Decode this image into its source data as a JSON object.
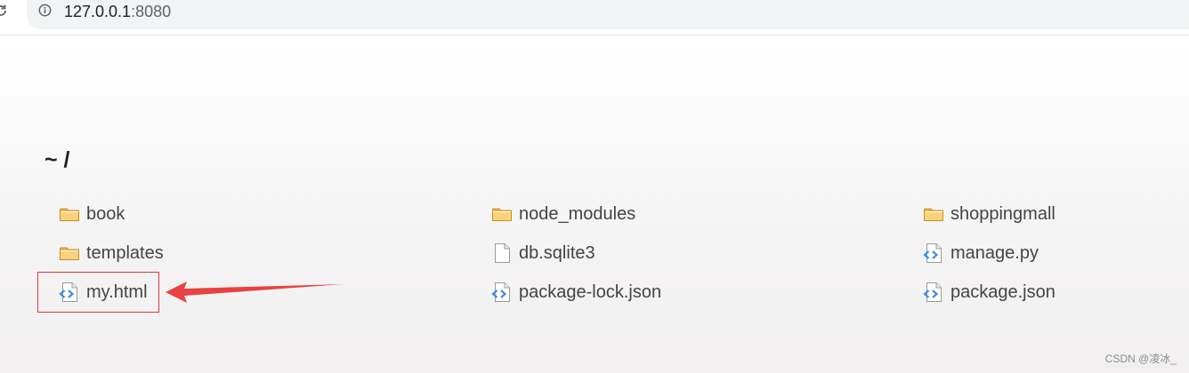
{
  "browser": {
    "url_host": "127.0.0.1",
    "url_port": ":8080"
  },
  "page": {
    "title": "~ /"
  },
  "files": [
    {
      "name": "book",
      "icon": "folder-icon"
    },
    {
      "name": "node_modules",
      "icon": "folder-icon"
    },
    {
      "name": "shoppingmall",
      "icon": "folder-icon"
    },
    {
      "name": "templates",
      "icon": "folder-icon"
    },
    {
      "name": "db.sqlite3",
      "icon": "file-icon"
    },
    {
      "name": "manage.py",
      "icon": "code-file-icon"
    },
    {
      "name": "my.html",
      "icon": "code-file-icon"
    },
    {
      "name": "package-lock.json",
      "icon": "code-file-icon"
    },
    {
      "name": "package.json",
      "icon": "code-file-icon"
    }
  ],
  "annotation": {
    "highlighted_file": "my.html",
    "color": "#e03a3a"
  },
  "watermark": "CSDN @凌冰_"
}
